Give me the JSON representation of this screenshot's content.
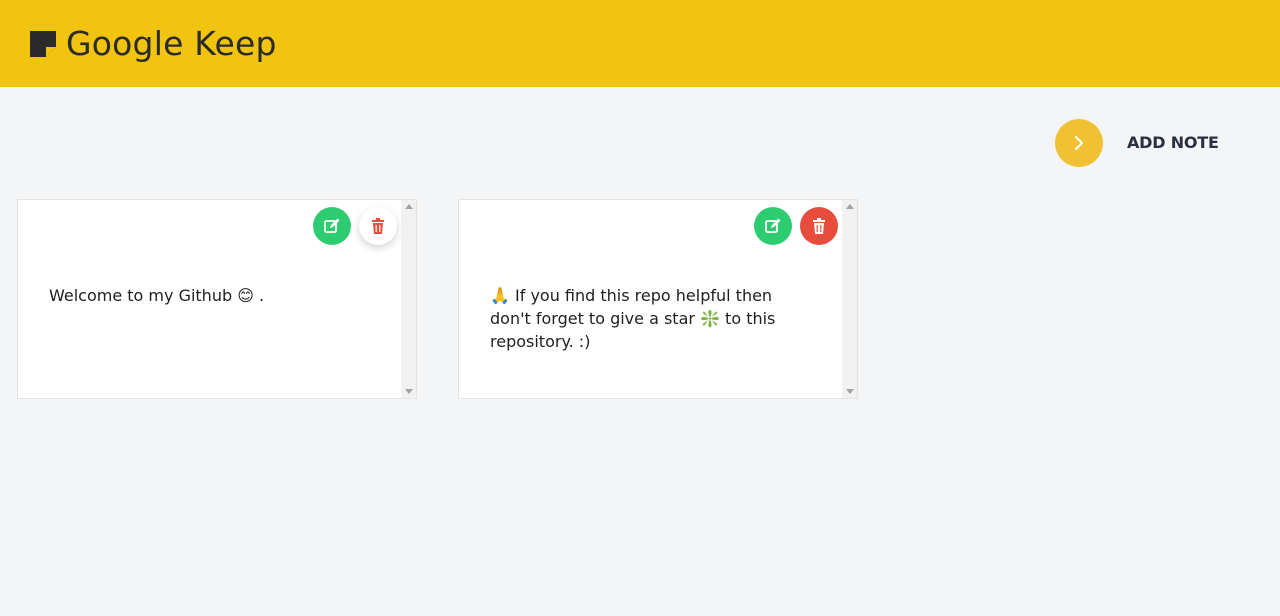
{
  "header": {
    "title": "Google Keep",
    "logo_icon": "sticky-note-icon",
    "background": "#f1c40f"
  },
  "toolbar": {
    "add_label": "ADD NOTE",
    "add_icon": "chevron-right-icon",
    "add_color": "#f0c233"
  },
  "notes": [
    {
      "text": "Welcome to my Github 😊 .",
      "edit_icon": "edit-icon",
      "delete_icon": "trash-icon"
    },
    {
      "text": "🙏 If you find this repo helpful then don't forget to give a star ❇️ to this repository. :)",
      "edit_icon": "edit-icon",
      "delete_icon": "trash-icon"
    }
  ],
  "colors": {
    "edit": "#2ecc71",
    "delete": "#e74c3c"
  }
}
